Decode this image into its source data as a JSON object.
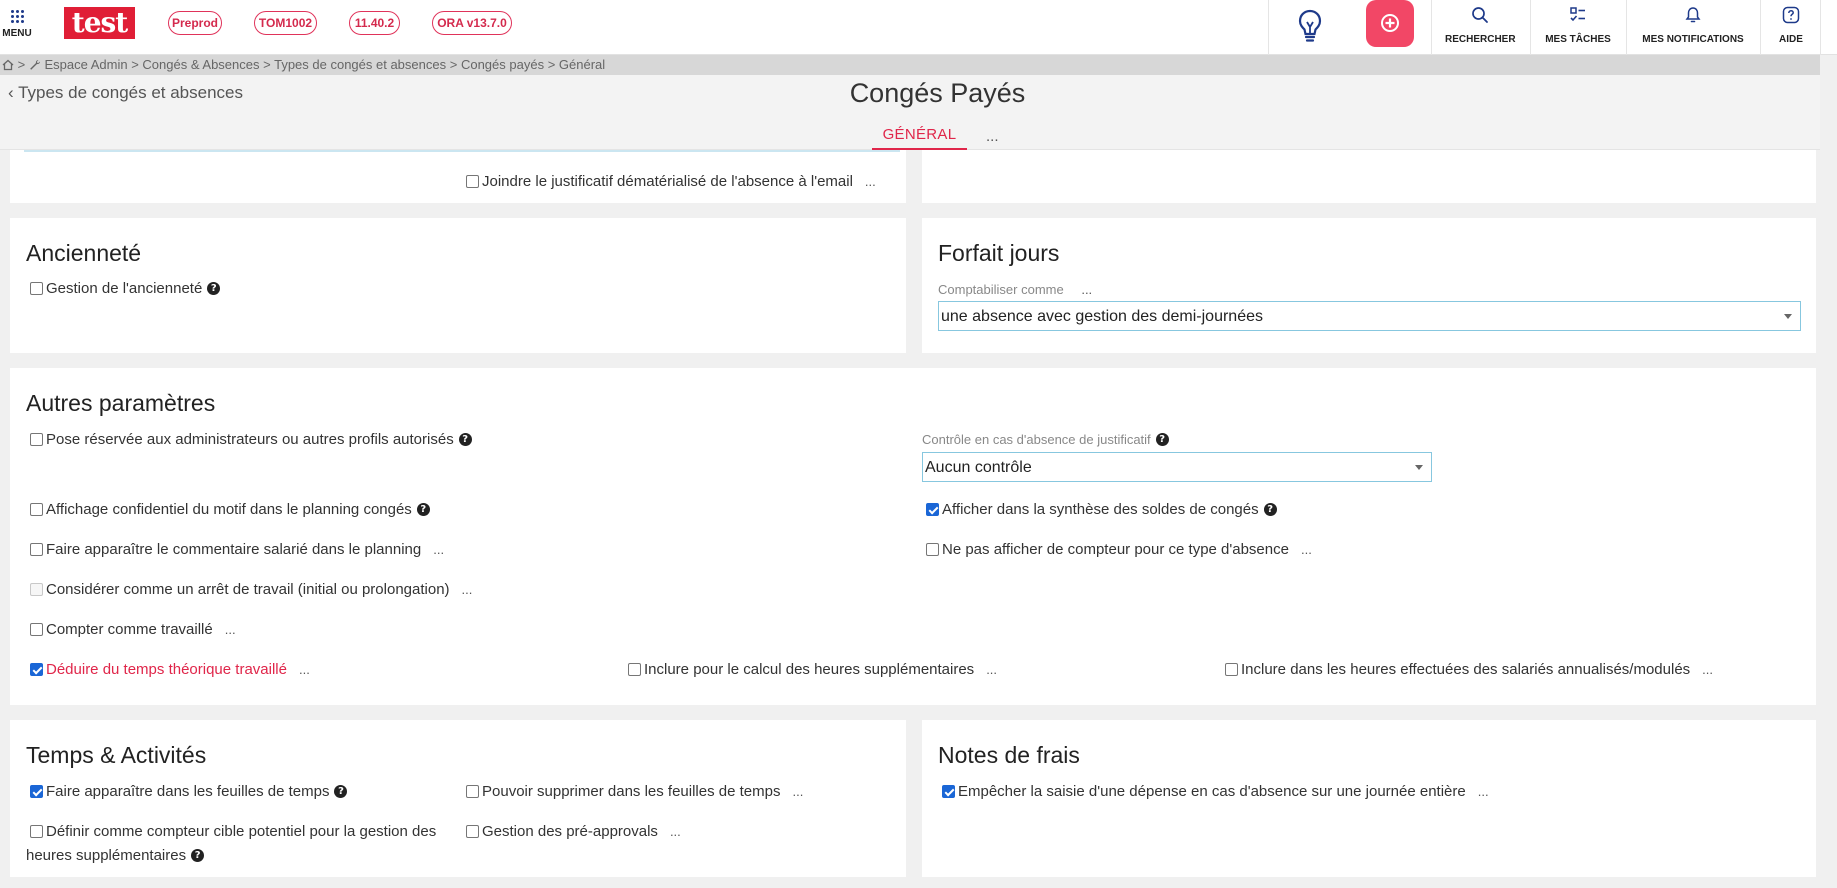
{
  "topbar": {
    "menu_label": "MENU",
    "logo_text": "test",
    "env_tags": [
      "Preprod",
      "TOM1002",
      "11.40.2",
      "ORA v13.7.0"
    ],
    "brand_color": "#e01e36",
    "accent_color": "#f24766",
    "tools": [
      {
        "label": "RECHERCHER",
        "icon": "search-icon"
      },
      {
        "label": "MES TÂCHES",
        "icon": "tasks-icon"
      },
      {
        "label": "MES NOTIFICATIONS",
        "icon": "bell-icon"
      },
      {
        "label": "AIDE",
        "icon": "help-icon"
      }
    ]
  },
  "breadcrumb": {
    "items": [
      "Espace Admin",
      "Congés & Absences",
      "Types de congés et absences",
      "Congés payés",
      "Général"
    ]
  },
  "page": {
    "back_label": "Types de congés et absences",
    "title": "Congés Payés",
    "tab_general": "GÉNÉRAL",
    "tab_more": "..."
  },
  "top_card": {
    "email_attach_label": "Joindre le justificatif dématérialisé de l'absence à l'email",
    "email_attach_checked": false,
    "more": "..."
  },
  "anciennete": {
    "title": "Ancienneté",
    "gestion_label": "Gestion de l'ancienneté",
    "gestion_checked": false
  },
  "forfait": {
    "title": "Forfait jours",
    "field_label": "Comptabiliser comme",
    "more": "...",
    "select_value": "une absence avec gestion des demi-journées"
  },
  "autres": {
    "title": "Autres paramètres",
    "pose_label": "Pose réservée aux administrateurs ou autres profils autorisés",
    "pose_checked": false,
    "controle_label": "Contrôle en cas d'absence de justificatif",
    "controle_value": "Aucun contrôle",
    "affichage_label": "Affichage confidentiel du motif dans le planning congés",
    "affichage_checked": false,
    "synthese_label": "Afficher dans la synthèse des soldes de congés",
    "synthese_checked": true,
    "commentaire_label": "Faire apparaître le commentaire salarié dans le planning",
    "commentaire_checked": false,
    "compteur_label": "Ne pas afficher de compteur pour ce type d'absence",
    "compteur_checked": false,
    "arret_label": "Considérer comme un arrêt de travail (initial ou prolongation)",
    "arret_checked": false,
    "travaille_label": "Compter comme travaillé",
    "travaille_checked": false,
    "deduire_label": "Déduire du temps théorique travaillé",
    "deduire_checked": true,
    "heures_sup_label": "Inclure pour le calcul des heures supplémentaires",
    "heures_sup_checked": false,
    "annualises_label": "Inclure dans les heures effectuées des salariés annualisés/modulés",
    "annualises_checked": false,
    "more": "..."
  },
  "temps": {
    "title": "Temps & Activités",
    "feuilles_label": "Faire apparaître dans les feuilles de temps",
    "feuilles_checked": true,
    "supprimer_label": "Pouvoir supprimer dans les feuilles de temps",
    "supprimer_checked": false,
    "cible_label_1": "Définir comme compteur cible potentiel pour la gestion des",
    "cible_label_2": "heures supplémentaires",
    "cible_checked": false,
    "preapprovals_label": "Gestion des pré-approvals",
    "preapprovals_checked": false,
    "more": "..."
  },
  "notes": {
    "title": "Notes de frais",
    "empecher_label": "Empêcher la saisie d'une dépense en cas d'absence sur une journée entière",
    "empecher_checked": true,
    "more": "..."
  }
}
